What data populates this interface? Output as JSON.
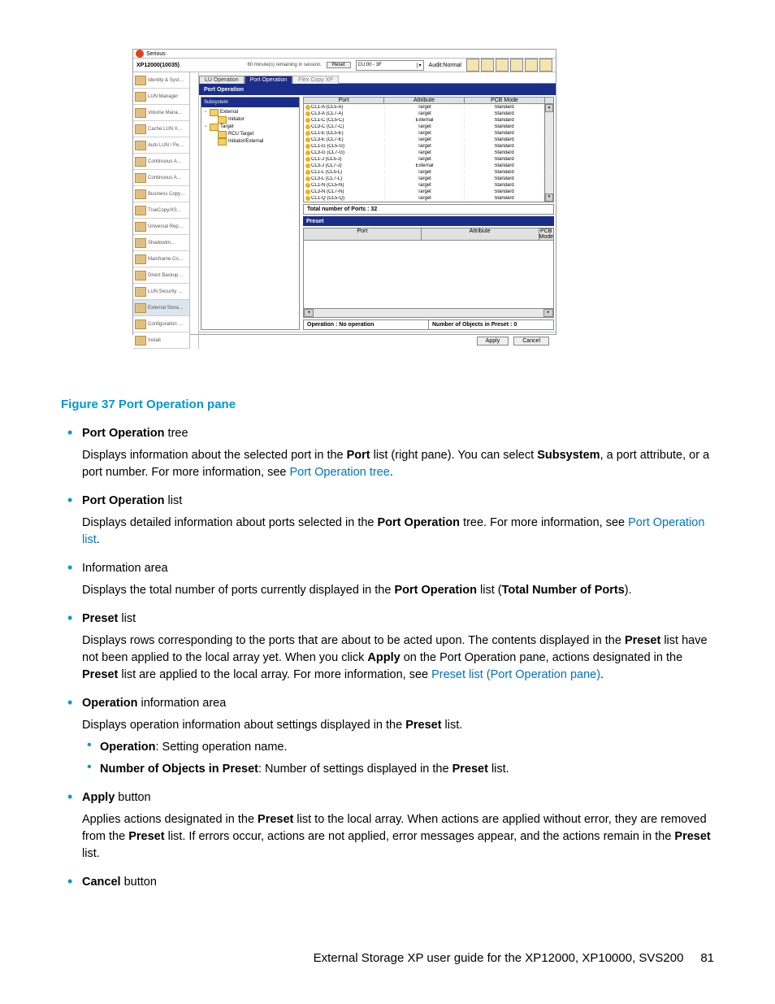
{
  "screenshot": {
    "app_title": "Serious",
    "subsystem_id": "XP12000(10035)",
    "session_msg": "60 minute(s) remaining in session.",
    "reset_btn": "Reset",
    "lun_dropdown": "CU:00 - 3F",
    "audit": "Audit:Normal",
    "sidebar": [
      "Identity & Syst…",
      "LUN Manager",
      "Volume Mana…",
      "Cache LUN X…",
      "Auto LUN / Pe…",
      "Continuous A…",
      "Continuous A…",
      "Business Copy…",
      "TrueCopy/XS…",
      "Universal Rep…",
      "Shadowim…",
      "Mainframe Co…",
      "Direct Backup…",
      "LUN Security …",
      "External Stora…",
      "Configuration …",
      "Install"
    ],
    "sidebar_selected": 14,
    "tabs": [
      "LU Operation",
      "Port Operation",
      "Flex Copy XP"
    ],
    "tab_active": 1,
    "section_title": "Port Operation",
    "tree_header": "Subsystem",
    "tree": [
      {
        "lvl": 0,
        "exp": "−",
        "label": "External"
      },
      {
        "lvl": 1,
        "exp": "",
        "label": "Initiator"
      },
      {
        "lvl": 0,
        "exp": "−",
        "label": "Target"
      },
      {
        "lvl": 1,
        "exp": "",
        "label": "RCU Target"
      },
      {
        "lvl": 1,
        "exp": "",
        "label": "Initiator/External"
      }
    ],
    "grid_headers": [
      "Port",
      "Attribute",
      "PCB Mode"
    ],
    "rows": [
      {
        "port": "CL1-A (CL5-A)",
        "attr": "Target",
        "pcb": "Standard"
      },
      {
        "port": "CL3-A (CL7-A)",
        "attr": "Target",
        "pcb": "Standard"
      },
      {
        "port": "CL1-C (CL5-C)",
        "attr": "External",
        "pcb": "Standard"
      },
      {
        "port": "CL3-C (CL7-C)",
        "attr": "Target",
        "pcb": "Standard"
      },
      {
        "port": "CL1-E (CL5-E)",
        "attr": "Target",
        "pcb": "Standard"
      },
      {
        "port": "CL3-E (CL7-E)",
        "attr": "Target",
        "pcb": "Standard"
      },
      {
        "port": "CL1-G (CL5-G)",
        "attr": "Target",
        "pcb": "Standard"
      },
      {
        "port": "CL3-G (CL7-G)",
        "attr": "Target",
        "pcb": "Standard"
      },
      {
        "port": "CL1-J (CL5-J)",
        "attr": "Target",
        "pcb": "Standard"
      },
      {
        "port": "CL3-J (CL7-J)",
        "attr": "External",
        "pcb": "Standard"
      },
      {
        "port": "CL1-L (CL5-L)",
        "attr": "Target",
        "pcb": "Standard"
      },
      {
        "port": "CL3-L (CL7-L)",
        "attr": "Target",
        "pcb": "Standard"
      },
      {
        "port": "CL1-N (CL5-N)",
        "attr": "Target",
        "pcb": "Standard"
      },
      {
        "port": "CL3-N (CL7-N)",
        "attr": "Target",
        "pcb": "Standard"
      },
      {
        "port": "CL1-Q (CL5-Q)",
        "attr": "Target",
        "pcb": "Standard"
      }
    ],
    "total_ports_label": "Total number of Ports :  32",
    "preset_title": "Preset",
    "preset_headers": [
      "Port",
      "Attribute",
      "PCB Mode"
    ],
    "op_label": "Operation :  No operation",
    "preset_count_label": "Number of Objects in Preset :  0",
    "apply_btn": "Apply",
    "cancel_btn": "Cancel"
  },
  "doc": {
    "figure_caption": "Figure 37 Port Operation pane",
    "items": [
      {
        "title_bold": "Port Operation",
        "title_rest": " tree",
        "body_pre": "Displays information about the selected port in the ",
        "body_bold1": "Port",
        "body_mid": " list (right pane). You can select ",
        "body_bold2": "Subsystem",
        "body_post": ", a port attribute, or a port number. For more information, see ",
        "link": "Port Operation tree",
        "tail": "."
      },
      {
        "title_bold": "Port Operation",
        "title_rest": " list",
        "body_pre": "Displays detailed information about ports selected in the ",
        "body_bold1": "Port Operation",
        "body_mid": " tree. For more information, see ",
        "link": "Port Operation list",
        "tail": "."
      },
      {
        "title_plain": "Information area",
        "body_pre": "Displays the total number of ports currently displayed in the ",
        "body_bold1": "Port Operation",
        "body_mid": " list (",
        "body_bold2": "Total Number of Ports",
        "tail": ")."
      },
      {
        "title_bold": "Preset",
        "title_rest": " list",
        "body_pre": "Displays rows corresponding to the ports that are about to be acted upon. The contents displayed in the ",
        "body_bold1": "Preset",
        "body_mid": " list have not been applied to the local array yet. When you click ",
        "body_bold2": "Apply",
        "body_mid2": " on the Port Operation pane, actions designated in the ",
        "body_bold3": "Preset",
        "body_post": " list are applied to the local array. For more information, see ",
        "link": "Preset list (Port Operation pane)",
        "tail": "."
      },
      {
        "title_bold": "Operation",
        "title_rest": " information area",
        "body_plain": "Displays operation information about settings displayed in the ",
        "body_bold1": "Preset",
        "tail": " list.",
        "sub": [
          {
            "b": "Operation",
            "t": ": Setting operation name."
          },
          {
            "b": "Number of Objects in Preset",
            "t": ": Number of settings displayed in the ",
            "b2": "Preset",
            "t2": " list."
          }
        ]
      },
      {
        "title_bold": "Apply",
        "title_rest": " button",
        "body_pre": "Applies actions designated in the ",
        "body_bold1": "Preset",
        "body_mid": " list to the local array. When actions are applied without error, they are removed from the ",
        "body_bold2": "Preset",
        "body_mid2": " list. If errors occur, actions are not applied, error messages appear, and the actions remain in the ",
        "body_bold3": "Preset",
        "tail": " list."
      },
      {
        "title_bold": "Cancel",
        "title_rest": " button"
      }
    ],
    "footer_text": "External Storage XP user guide for the XP12000, XP10000, SVS200",
    "page_number": "81"
  }
}
